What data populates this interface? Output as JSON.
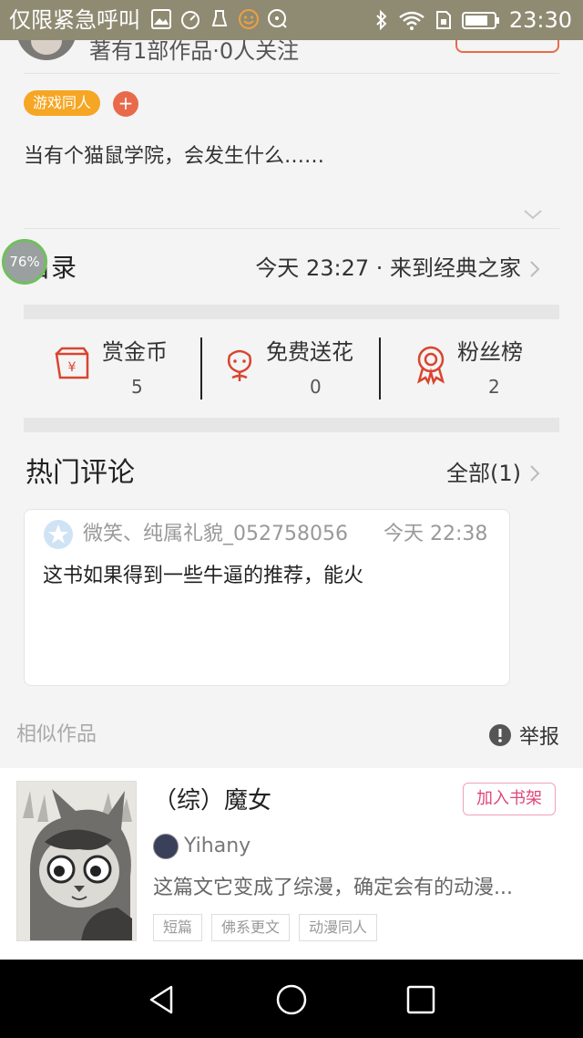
{
  "status_bar": {
    "left_text": "仅限紧急呼叫",
    "time": "23:30",
    "icons_left": [
      "gallery-icon",
      "speedometer-icon",
      "cleaner-icon",
      "emoji-icon",
      "chat-bubble-icon"
    ],
    "icons_right": [
      "bluetooth-icon",
      "wifi-icon",
      "sim-icon",
      "battery-icon"
    ]
  },
  "author": {
    "works_meta": "著有1部作品·0人关注"
  },
  "tags": {
    "genre": "游戏同人",
    "add_symbol": "+"
  },
  "summary": {
    "text": "当有个猫鼠学院，会发生什么……"
  },
  "float_badge": {
    "text": "76%"
  },
  "toc": {
    "title": "目录",
    "latest": "今天 23:27 · 来到经典之家"
  },
  "stats": [
    {
      "label": "赏金币",
      "value": "5",
      "icon": "reward-coin-icon"
    },
    {
      "label": "免费送花",
      "value": "0",
      "icon": "flower-icon"
    },
    {
      "label": "粉丝榜",
      "value": "2",
      "icon": "medal-icon"
    }
  ],
  "comments": {
    "title": "热门评论",
    "all_link": "全部(1)",
    "items": [
      {
        "user": "微笑、纯属礼貌_052758056",
        "time": "今天 22:38",
        "text": "这书如果得到一些牛逼的推荐，能火"
      }
    ]
  },
  "similar": {
    "label": "相似作品",
    "report": "举报",
    "book": {
      "title": "（综）魔女",
      "add_button": "加入书架",
      "author": "Yihany",
      "description": "这篇文它变成了综漫，确定会有的动漫...",
      "tags": [
        "短篇",
        "佛系更文",
        "动漫同人"
      ]
    }
  },
  "colors": {
    "accent": "#e86a4a",
    "tag": "#f5a623",
    "status_bar": "#8f8a72",
    "shelf_button": "#e0457b"
  }
}
